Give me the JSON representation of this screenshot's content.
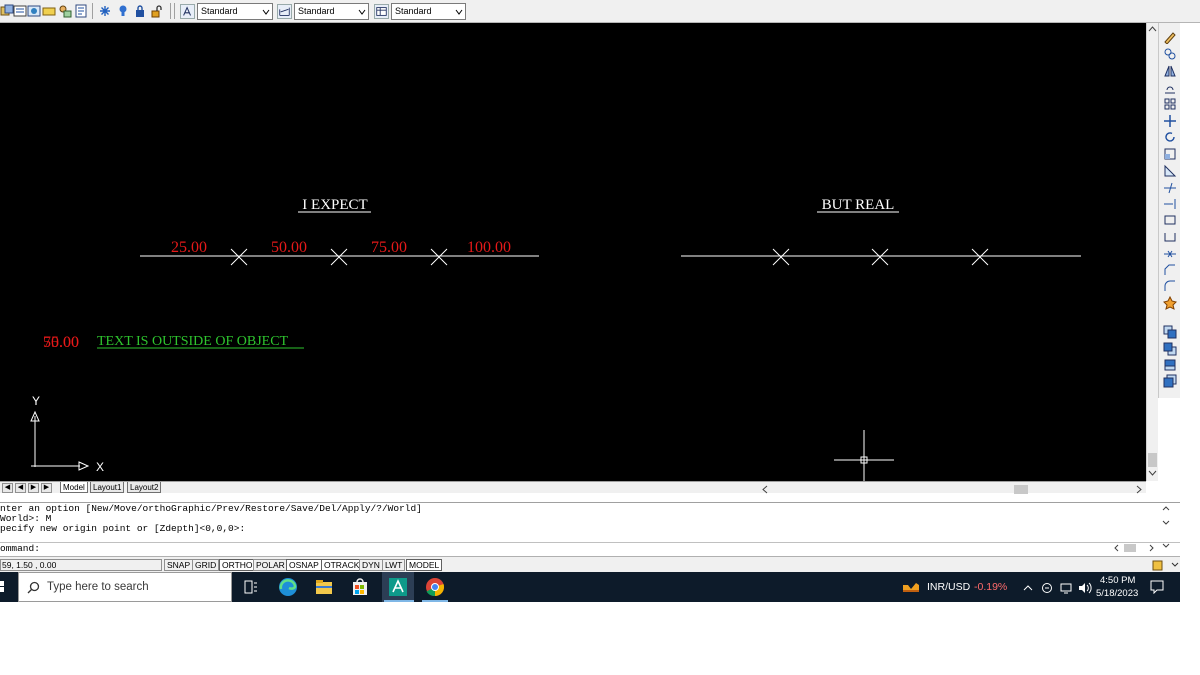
{
  "toolbar": {
    "text_style": "Standard",
    "dim_style": "Standard",
    "table_style": "Standard"
  },
  "drawing": {
    "left_title": "I EXPECT",
    "right_title": "BUT REAL",
    "expected_labels": [
      "25.00",
      "50.00",
      "75.00",
      "100.00"
    ],
    "overlap_label_a": "50.00",
    "overlap_label_b": "75.00",
    "note": "TEXT IS OUTSIDE OF OBJECT",
    "ucs_x": "X",
    "ucs_y": "Y",
    "colors": {
      "background": "#000000",
      "line": "#ffffff",
      "dim_text": "#e61919",
      "note_text": "#2ec52e"
    }
  },
  "tabs": {
    "model": "Model",
    "layout1": "Layout1",
    "layout2": "Layout2"
  },
  "command": {
    "line1": "nter an option [New/Move/orthoGraphic/Prev/Restore/Save/Del/Apply/?/World]",
    "line2": "World>: M",
    "line3": "pecify new origin point or [Zdepth]<0,0,0>:",
    "prompt": "ommand:"
  },
  "status": {
    "coords": "59, 1.50 , 0.00",
    "snap": "SNAP",
    "grid": "GRID",
    "ortho": "ORTHO",
    "polar": "POLAR",
    "osnap": "OSNAP",
    "otrack": "OTRACK",
    "dyn": "DYN",
    "lwt": "LWT",
    "model": "MODEL"
  },
  "taskbar": {
    "search_placeholder": "Type here to search",
    "ticker_label": "INR/USD",
    "ticker_change": "-0.19%",
    "time": "4:50 PM",
    "date": "5/18/2023"
  }
}
